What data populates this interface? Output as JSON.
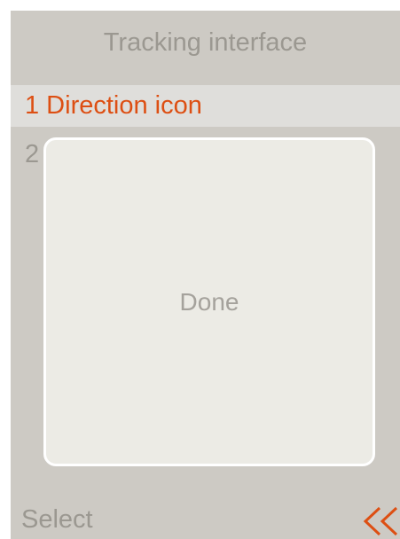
{
  "header": {
    "title": "Tracking interface"
  },
  "menu": {
    "items": [
      {
        "label": "1 Direction icon",
        "selected": true
      },
      {
        "label": "2",
        "selected": false
      }
    ]
  },
  "dialog": {
    "message": "Done"
  },
  "footer": {
    "left_label": "Select",
    "right_icon": "double-chevron-left-icon"
  },
  "colors": {
    "screen_bg": "#cdcac4",
    "highlight_bg": "#dfdedb",
    "accent": "#dd4f13",
    "text_muted": "#9b9891",
    "dialog_bg": "#ecebe5",
    "dialog_border": "#ffffff"
  }
}
